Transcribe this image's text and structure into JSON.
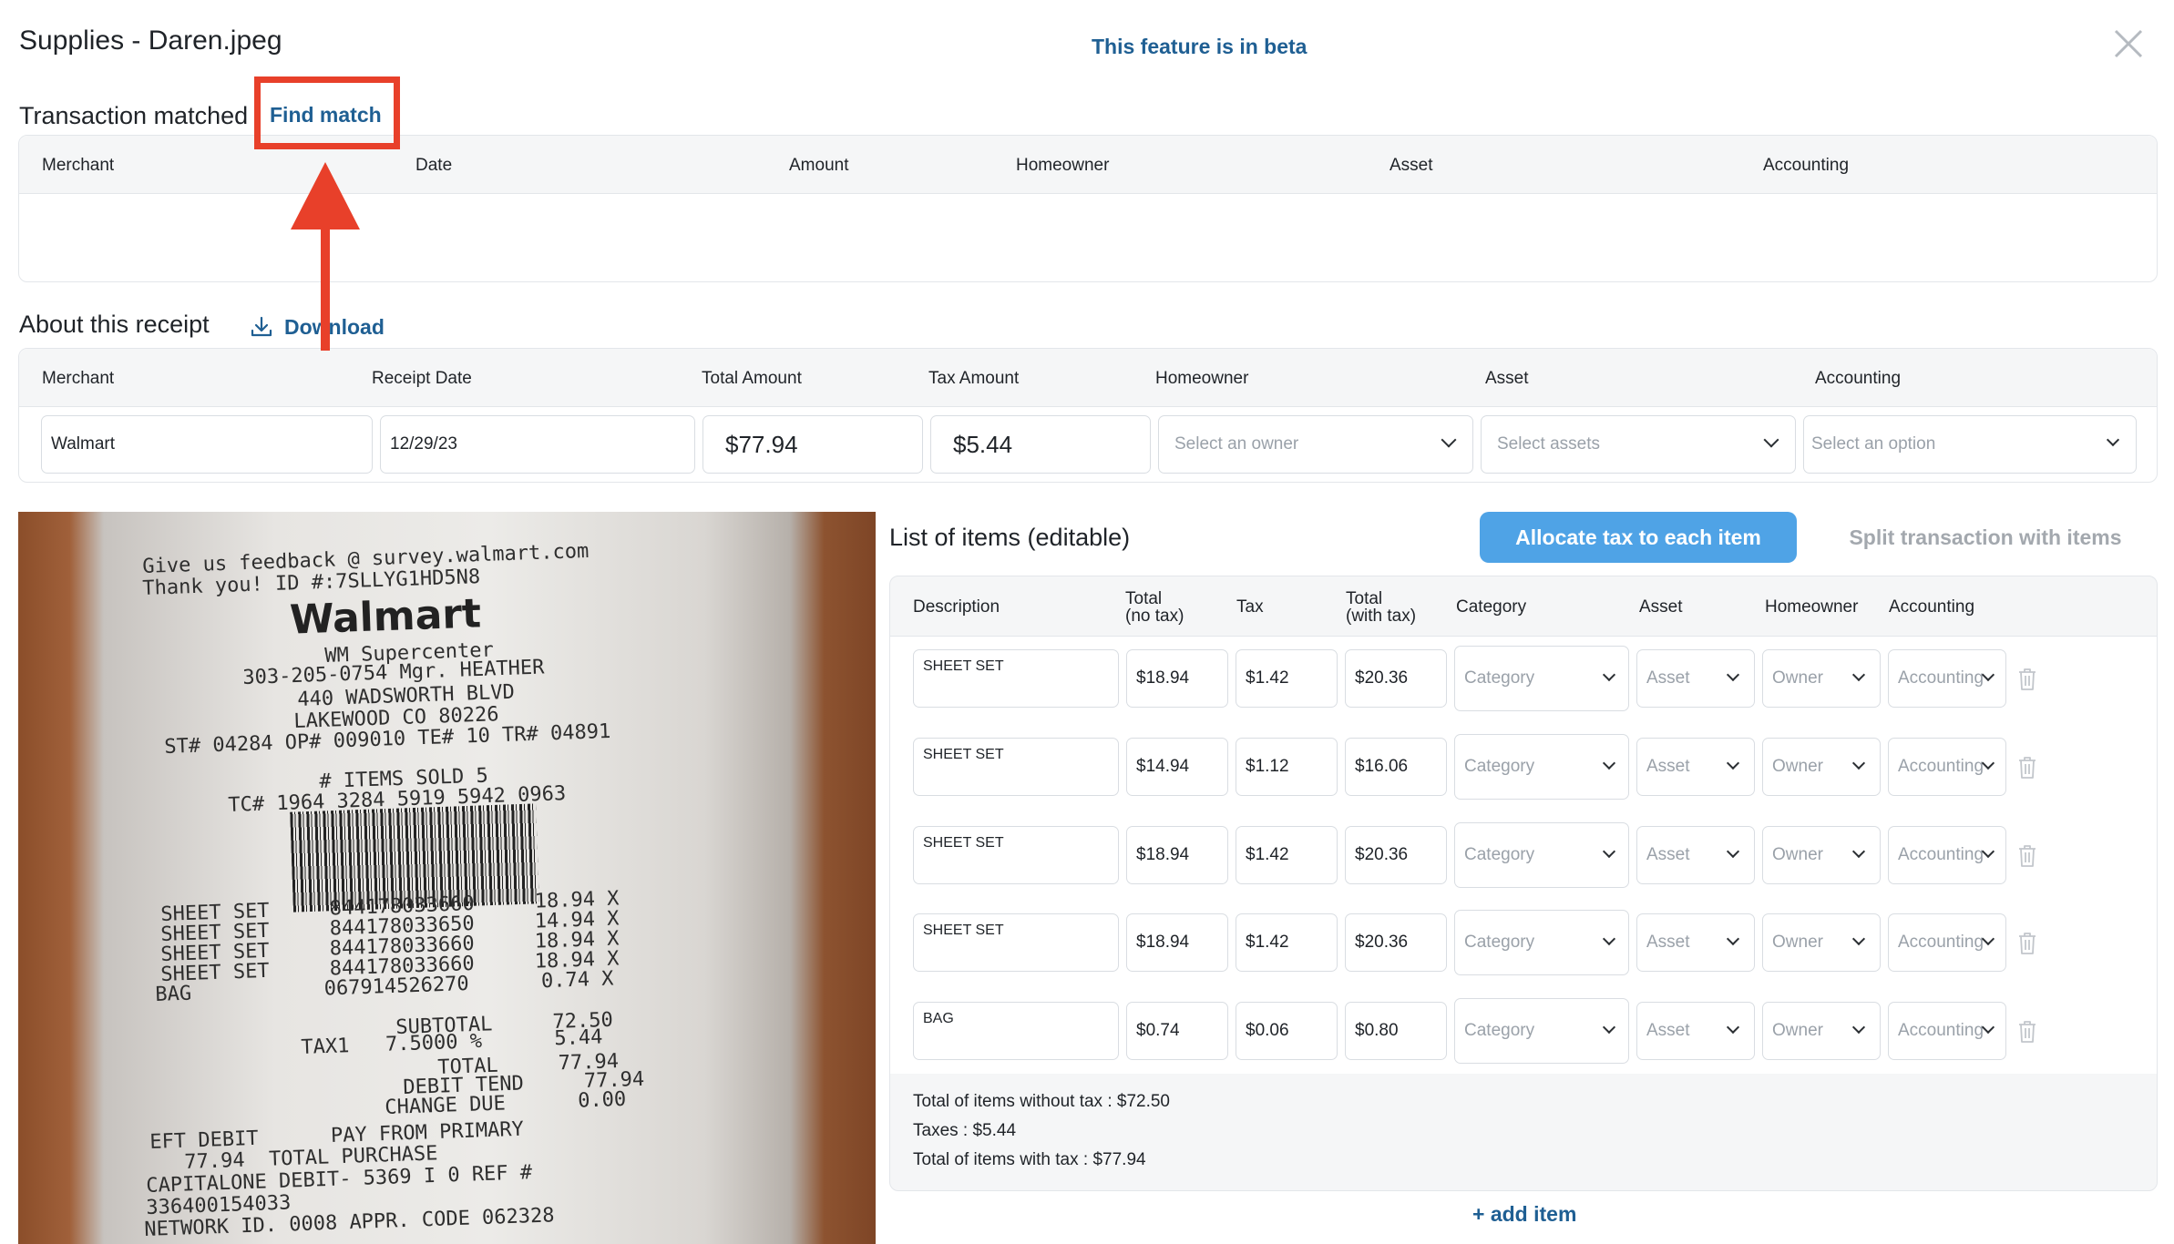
{
  "header": {
    "title": "Supplies - Daren.jpeg",
    "beta_notice": "This feature is in beta"
  },
  "transaction": {
    "label": "Transaction matched",
    "find_match": "Find match",
    "columns": [
      "Merchant",
      "Date",
      "Amount",
      "Homeowner",
      "Asset",
      "Accounting"
    ]
  },
  "receipt_info": {
    "label": "About this receipt",
    "download": "Download",
    "columns": [
      "Merchant",
      "Receipt Date",
      "Total Amount",
      "Tax Amount",
      "Homeowner",
      "Asset",
      "Accounting"
    ],
    "merchant": "Walmart",
    "date": "12/29/23",
    "total": "$77.94",
    "tax": "$5.44",
    "homeowner_placeholder": "Select an owner",
    "asset_placeholder": "Select assets",
    "accounting_placeholder": "Select an option"
  },
  "receipt_image": {
    "lines": [
      "Give us feedback @ survey.walmart.com",
      "Thank you! ID #:7SLLYG1HD5N8",
      "WM Supercenter",
      "303-205-0754 Mgr. HEATHER",
      "440 WADSWORTH BLVD",
      "LAKEWOOD CO 80226",
      "ST# 04284 OP# 009010 TE# 10 TR# 04891",
      "# ITEMS SOLD 5",
      "TC# 1964 3284 5919 5942 0963",
      "SHEET SET     844178033660     18.94 X",
      "SHEET SET     844178033650     14.94 X",
      "SHEET SET     844178033660     18.94 X",
      "SHEET SET     844178033660     18.94 X",
      "BAG           067914526270      0.74 X",
      "SUBTOTAL     72.50",
      "TAX1   7.5000 %      5.44",
      "TOTAL     77.94",
      "DEBIT TEND     77.94",
      "CHANGE DUE      0.00",
      "EFT DEBIT      PAY FROM PRIMARY",
      "77.94  TOTAL PURCHASE",
      "CAPITALONE DEBIT- 5369 I 0 REF #",
      "336400154033",
      "NETWORK ID. 0008 APPR. CODE 062328"
    ],
    "logo": "Walmart"
  },
  "items": {
    "title": "List of items (editable)",
    "allocate_button": "Allocate tax to each item",
    "split_button": "Split transaction with items",
    "columns": {
      "description": "Description",
      "total_no_tax_1": "Total",
      "total_no_tax_2": "(no tax)",
      "tax": "Tax",
      "total_with_tax_1": "Total",
      "total_with_tax_2": "(with tax)",
      "category": "Category",
      "asset": "Asset",
      "homeowner": "Homeowner",
      "accounting": "Accounting"
    },
    "placeholders": {
      "category": "Category",
      "asset": "Asset",
      "owner": "Owner",
      "accounting": "Accounting"
    },
    "rows": [
      {
        "description": "SHEET SET",
        "total": "$18.94",
        "tax": "$1.42",
        "with_tax": "$20.36"
      },
      {
        "description": "SHEET SET",
        "total": "$14.94",
        "tax": "$1.12",
        "with_tax": "$16.06"
      },
      {
        "description": "SHEET SET",
        "total": "$18.94",
        "tax": "$1.42",
        "with_tax": "$20.36"
      },
      {
        "description": "SHEET SET",
        "total": "$18.94",
        "tax": "$1.42",
        "with_tax": "$20.36"
      },
      {
        "description": "BAG",
        "total": "$0.74",
        "tax": "$0.06",
        "with_tax": "$0.80"
      }
    ],
    "summary": {
      "without_tax": "Total of items without tax : $72.50",
      "taxes": "Taxes : $5.44",
      "with_tax": "Total of items with tax : $77.94"
    },
    "add_item": "+ add item"
  }
}
